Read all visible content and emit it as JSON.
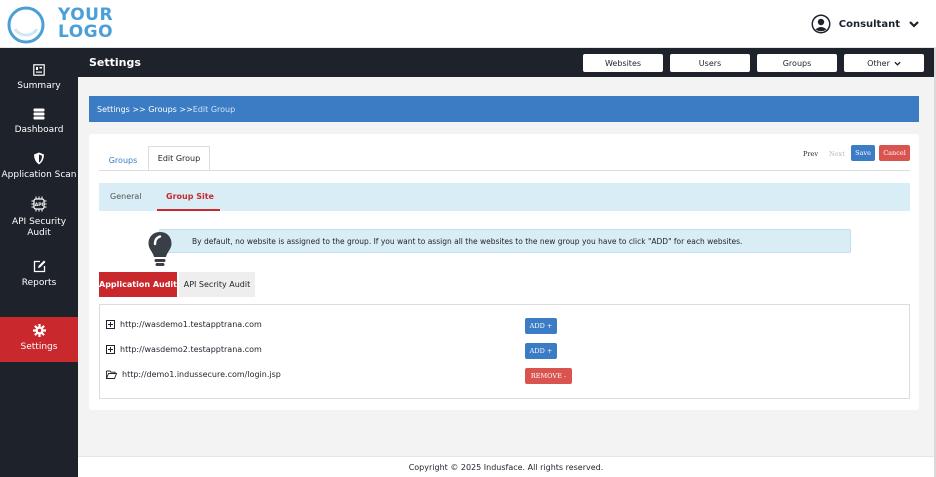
{
  "header": {
    "logo_line1": "YOUR",
    "logo_line2": "LOGO",
    "user_name": "Consultant",
    "brand_color": "#4a9fd8"
  },
  "sidebar": {
    "items": [
      {
        "label": "Summary",
        "icon": "summary-icon"
      },
      {
        "label": "Dashboard",
        "icon": "dashboard-icon"
      },
      {
        "label": "Application Scan",
        "icon": "shield-icon"
      },
      {
        "label": "API Security Audit",
        "icon": "api-icon"
      },
      {
        "label": "Reports",
        "icon": "edit-icon"
      },
      {
        "label": "Settings",
        "icon": "gear-icon",
        "active": true
      }
    ]
  },
  "settings_bar": {
    "title": "Settings",
    "buttons": [
      "Websites",
      "Users",
      "Groups",
      "Other"
    ]
  },
  "breadcrumb": {
    "path": "Settings >> Groups >> ",
    "current": "Edit Group"
  },
  "tabs": [
    "Groups",
    "Edit Group"
  ],
  "pager": {
    "prev": "Prev",
    "next": "Next",
    "save": "Save",
    "cancel": "Cancel"
  },
  "subtabs": [
    "General",
    "Group Site"
  ],
  "info_text": "By default, no website is assigned to the group. If you want to assign all the websites to the new group you have to click \"ADD\" for each websites.",
  "audit_tabs": [
    "Application Audit",
    "API Secrity Audit"
  ],
  "sites": [
    {
      "url": "http://wasdemo1.testapptrana.com",
      "action": "ADD +"
    },
    {
      "url": "http://wasdemo2.testapptrana.com",
      "action": "ADD +"
    },
    {
      "url": "http://demo1.indussecure.com/login.jsp",
      "action": "REMOVE -"
    }
  ],
  "footer": "Copyright © 2025 Indusface. All rights reserved.",
  "colors": {
    "primary": "#3b7cc4",
    "danger": "#c9282d",
    "sidebar": "#1e222b"
  }
}
